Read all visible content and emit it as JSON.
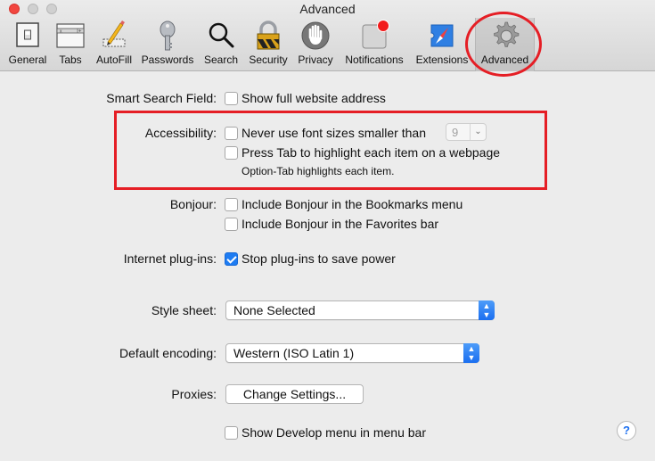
{
  "window": {
    "title": "Advanced",
    "accent_color": "#1e7cf2",
    "annotation_color": "#e51e25"
  },
  "toolbar": {
    "items": [
      {
        "label": "General",
        "icon": "general-switch-icon"
      },
      {
        "label": "Tabs",
        "icon": "tabs-icon"
      },
      {
        "label": "AutoFill",
        "icon": "autofill-pencil-icon"
      },
      {
        "label": "Passwords",
        "icon": "key-icon"
      },
      {
        "label": "Search",
        "icon": "magnifier-icon"
      },
      {
        "label": "Security",
        "icon": "padlock-icon"
      },
      {
        "label": "Privacy",
        "icon": "hand-icon"
      },
      {
        "label": "Notifications",
        "icon": "notification-badge-icon"
      },
      {
        "label": "Extensions",
        "icon": "puzzle-compass-icon"
      },
      {
        "label": "Advanced",
        "icon": "gear-icon",
        "selected": true
      }
    ]
  },
  "settings": {
    "smart_search": {
      "label": "Smart Search Field:",
      "option": "Show full website address",
      "checked": false
    },
    "accessibility": {
      "label": "Accessibility:",
      "font_option": "Never use font sizes smaller than",
      "font_checked": false,
      "font_size": "9",
      "tab_option": "Press Tab to highlight each item on a webpage",
      "tab_checked": false,
      "note": "Option-Tab highlights each item."
    },
    "bonjour": {
      "label": "Bonjour:",
      "bookmarks_option": "Include Bonjour in the Bookmarks menu",
      "bookmarks_checked": false,
      "favorites_option": "Include Bonjour in the Favorites bar",
      "favorites_checked": false
    },
    "plugins": {
      "label": "Internet plug-ins:",
      "option": "Stop plug-ins to save power",
      "checked": true
    },
    "stylesheet": {
      "label": "Style sheet:",
      "value": "None Selected"
    },
    "encoding": {
      "label": "Default encoding:",
      "value": "Western (ISO Latin 1)"
    },
    "proxies": {
      "label": "Proxies:",
      "button": "Change Settings..."
    },
    "develop": {
      "option": "Show Develop menu in menu bar",
      "checked": false
    },
    "help_label": "?"
  }
}
